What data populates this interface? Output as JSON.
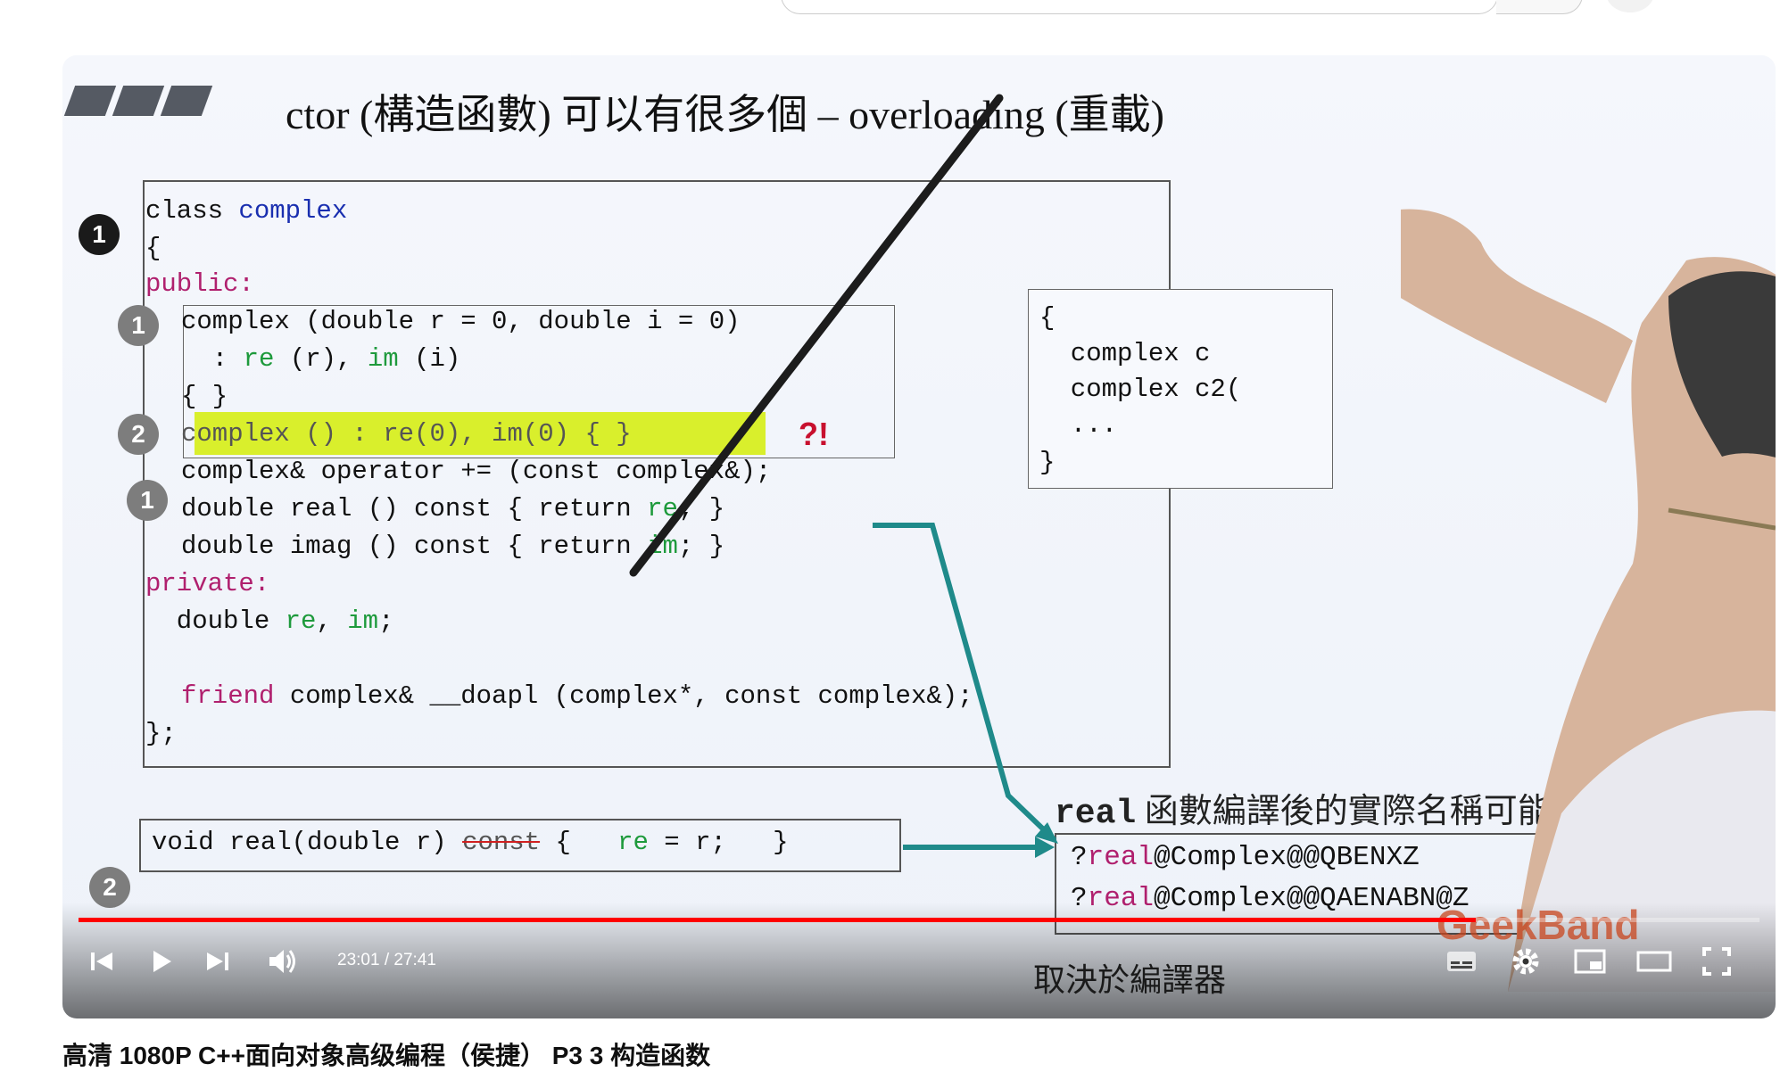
{
  "video": {
    "time": "23:01 / 27:41",
    "progress_fraction": 0.831,
    "title": "高清 1080P C++面向对象高级编程（侯捷） P3 3 构造函数"
  },
  "slide": {
    "title": "ctor (構造函數) 可以有很多個 – overloading (重載)",
    "badges": [
      "1",
      "1",
      "2",
      "1",
      "2"
    ],
    "code": {
      "l1a": "class ",
      "l1b": "complex",
      "l2": "{",
      "l3": "public:",
      "c1": "complex (double r = 0, double i = 0)",
      "c2a": "  : ",
      "c2b": "re",
      "c2c": " (r), ",
      "c2d": "im",
      "c2e": " (i)",
      "c3": "{ }",
      "c4": "complex () : re(0), im(0) { }",
      "c4mark": "?!",
      "c5": "complex& operator += (const complex&);",
      "c6a": "double real () const { return ",
      "c6b": "re",
      "c6c": "; }",
      "c7a": "double imag () const { return ",
      "c7b": "im",
      "c7c": "; }",
      "c8": "private:",
      "c9a": "  double ",
      "c9b": "re",
      "c9c": ", ",
      "c9d": "im",
      "c9e": ";",
      "c10a": "friend",
      "c10b": " complex& __doapl (complex*, const complex&);",
      "c11": "};"
    },
    "right_box": {
      "l1": "{",
      "l2": "  complex c",
      "l3": "  complex c2(",
      "l4": "  ...",
      "l5": "}"
    },
    "bottom_code": {
      "a": "void real(double r) ",
      "b": "const",
      "c": " {   ",
      "d": "re",
      "e": " = r;   }"
    },
    "caption_a": "real",
    "caption_b": " 函數編譯後的實際名稱可能是：",
    "mangle1a": "?",
    "mangle1b": "real",
    "mangle1c": "@Complex@@QBENXZ",
    "mangle2a": "?",
    "mangle2b": "real",
    "mangle2c": "@Complex@@QAENABN@Z",
    "subtitle": "取決於編譯器",
    "watermark": "GeekBand"
  },
  "icons": [
    "previous-icon",
    "play-icon",
    "next-icon",
    "volume-icon",
    "subtitles-icon",
    "settings-icon",
    "miniplayer-icon",
    "theater-icon",
    "fullscreen-icon"
  ],
  "colors": {
    "progress": "#ff0000",
    "highlight": "#d9ef2c",
    "arrow": "#1f8a8a",
    "keyword": "#b0206e",
    "type": "#1a2fb0",
    "member": "#1e9a3c"
  }
}
